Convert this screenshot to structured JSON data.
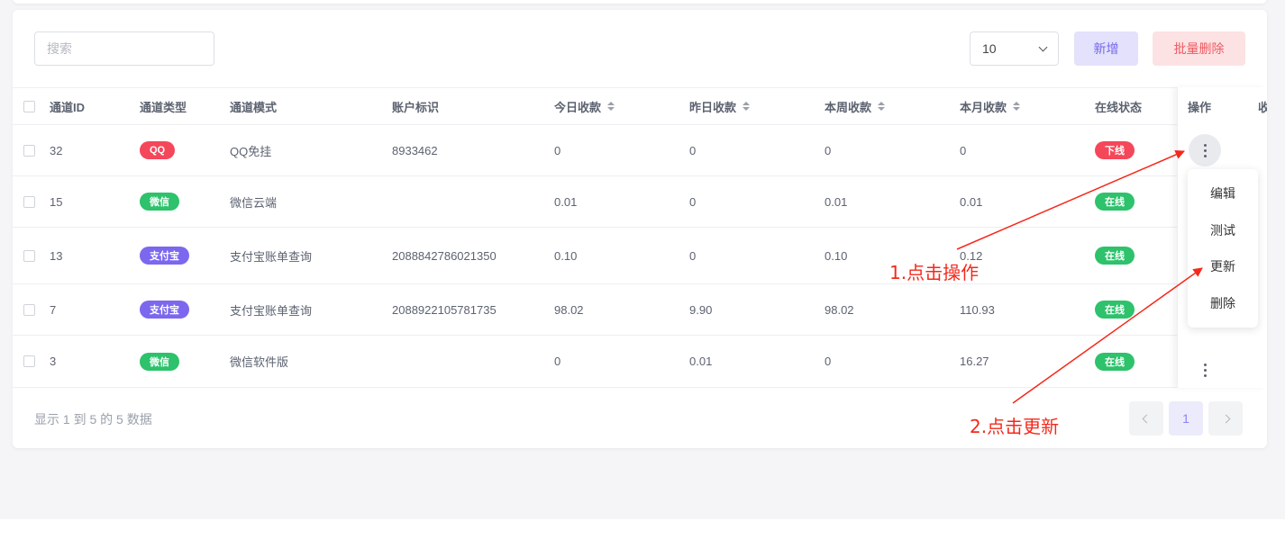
{
  "toolbar": {
    "search_placeholder": "搜索",
    "page_size": "10",
    "add_label": "新增",
    "bulk_delete_label": "批量删除"
  },
  "table": {
    "headers": {
      "id": "通道ID",
      "type": "通道类型",
      "mode": "通道模式",
      "account": "账户标识",
      "today": "今日收款",
      "yesterday": "昨日收款",
      "week": "本周收款",
      "month": "本月收款",
      "status": "在线状态",
      "action": "操作",
      "extra": "收"
    },
    "rows": [
      {
        "id": "32",
        "type": "QQ",
        "type_color": "#f5475a",
        "mode": "QQ免挂",
        "account": "8933462",
        "today": "0",
        "yesterday": "0",
        "week": "0",
        "month": "0",
        "status": "下线",
        "status_color": "#f5475a"
      },
      {
        "id": "15",
        "type": "微信",
        "type_color": "#2dc26b",
        "mode": "微信云端",
        "account": "",
        "today": "0.01",
        "yesterday": "0",
        "week": "0.01",
        "month": "0.01",
        "status": "在线",
        "status_color": "#2dc26b"
      },
      {
        "id": "13",
        "type": "支付宝",
        "type_color": "#7b68ee",
        "mode": "支付宝账单查询",
        "account": "2088842786021350",
        "today": "0.10",
        "yesterday": "0",
        "week": "0.10",
        "month": "0.12",
        "status": "在线",
        "status_color": "#2dc26b"
      },
      {
        "id": "7",
        "type": "支付宝",
        "type_color": "#7b68ee",
        "mode": "支付宝账单查询",
        "account": "2088922105781735",
        "today": "98.02",
        "yesterday": "9.90",
        "week": "98.02",
        "month": "110.93",
        "status": "在线",
        "status_color": "#2dc26b"
      },
      {
        "id": "3",
        "type": "微信",
        "type_color": "#2dc26b",
        "mode": "微信软件版",
        "account": "",
        "today": "0",
        "yesterday": "0.01",
        "week": "0",
        "month": "16.27",
        "status": "在线",
        "status_color": "#2dc26b"
      }
    ]
  },
  "action_menu": {
    "items": [
      "编辑",
      "测试",
      "更新",
      "删除"
    ]
  },
  "footer": {
    "summary": "显示 1 到 5 的 5 数据",
    "current_page": "1"
  },
  "annotations": {
    "step1": "1.点击操作",
    "step2": "2.点击更新",
    "color": "#f5281b"
  }
}
